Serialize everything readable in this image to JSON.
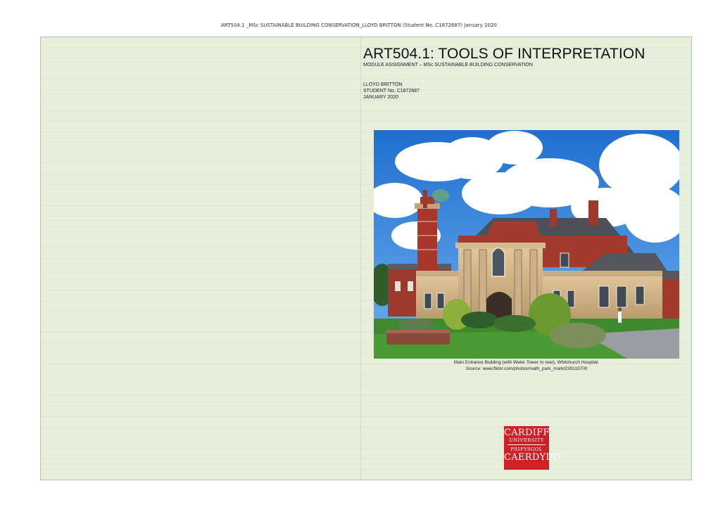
{
  "document": {
    "running_header": "ART504.1 _MSc SUSTAINABLE BUILDING CONSERVATION_LLOYD BRITTON (Student No. C1872687) January 2020",
    "title": "ART504.1: TOOLS OF INTERPRETATION",
    "subtitle": "MODULE ASSIGNMENT – MSc SUSTAINABLE BUILDING CONSERVATION",
    "author": "LLOYD BRITTON",
    "student_no": "STUDENT No. C1872687",
    "date": "JANUARY 2020"
  },
  "photo": {
    "caption": "Main Entrance Building (with Water Tower to rear), Whitchurch Hospital.",
    "source_label": "Source:",
    "source_url": "www.flickr.com/photos/roath_park_mark/239113700"
  },
  "logo": {
    "line1": "CARDIFF",
    "line2": "UNIVERSITY",
    "line3": "PRIFYSGOL",
    "line4": "CAERDYDD",
    "color": "#cf2027"
  },
  "colors": {
    "sheet_background": "#e7eedc"
  }
}
